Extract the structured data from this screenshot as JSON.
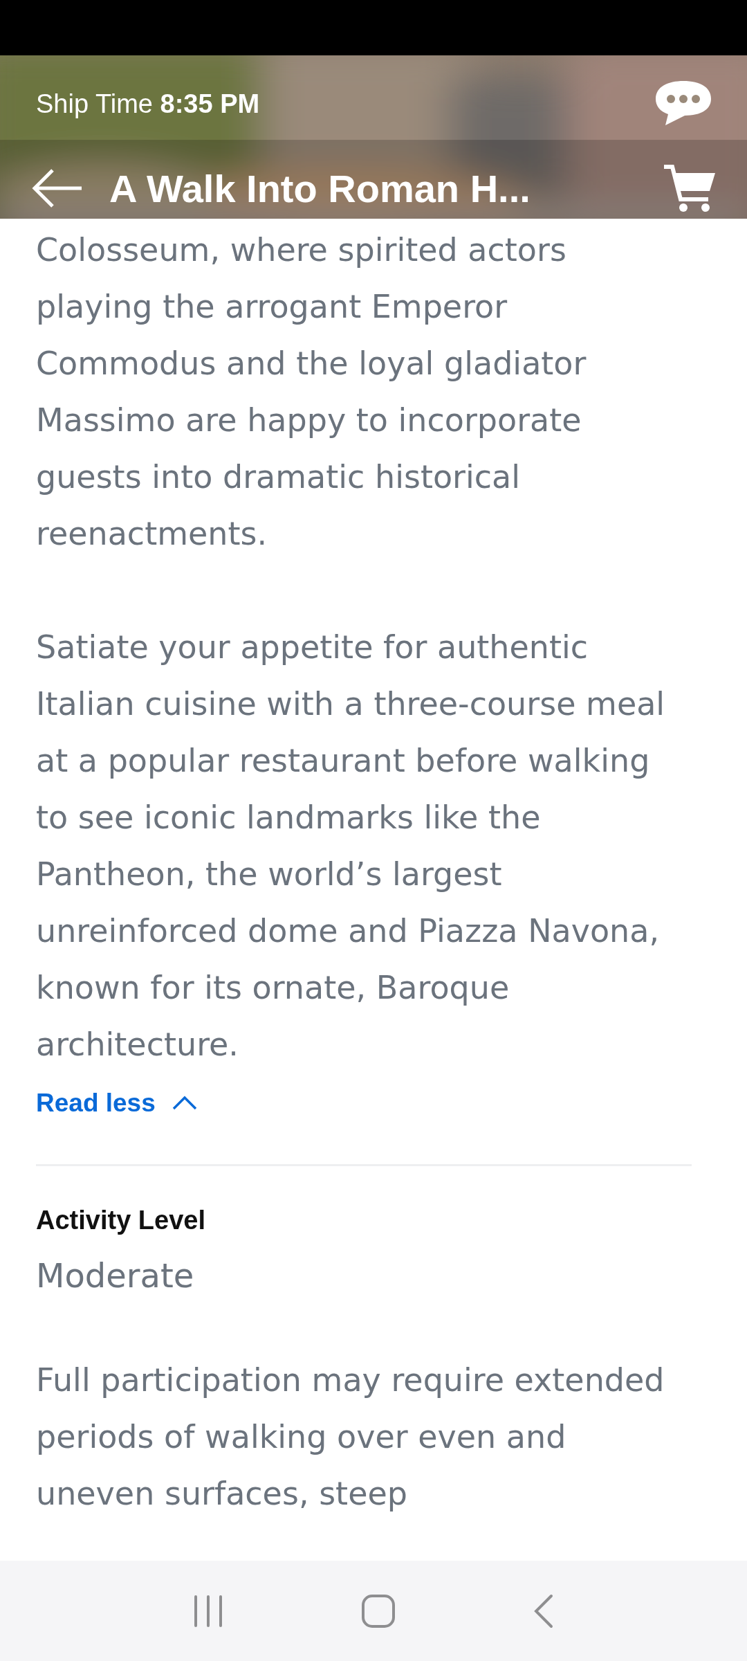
{
  "header": {
    "ship_time_label": "Ship Time",
    "ship_time": "8:35 PM",
    "title": "A Walk Into Roman H..."
  },
  "description": {
    "paragraphs": [
      "Colosseum, where spirited actors playing the arrogant Emperor Commodus and the loyal gladiator Massimo are happy to incorporate guests into dramatic historical reenactments.",
      "Satiate your appetite for authentic Italian cuisine with a three-course meal at a popular restaurant before walking to see iconic landmarks like the Pantheon, the world’s largest unreinforced dome and Piazza Navona, known for its ornate, Baroque architecture."
    ],
    "toggle": "Read less",
    "expanded": true
  },
  "activity": {
    "heading": "Activity Level",
    "value": "Moderate",
    "note": "Full participation may require extended periods of walking over even and uneven surfaces, steep"
  }
}
